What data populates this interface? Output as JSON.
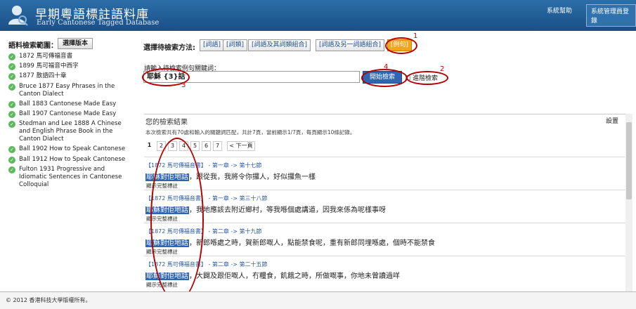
{
  "header": {
    "title_zh": "早期粵語標註語料庫",
    "title_en": "Early Cantonese Tagged Database",
    "help_link": "系統幫助",
    "admin_login": "系統管理員登錄"
  },
  "sidebar": {
    "scope_label": "語料檢索範圍：",
    "select_button": "選擇版本",
    "corpora": [
      "1872 馬可傳福音書",
      "1899 馬可福音中西字",
      "1877 散語四十章",
      "Bruce 1877 Easy Phrases in the Canton Dialect",
      "Ball 1883 Cantonese Made Easy",
      "Ball 1907 Cantonese Made Easy",
      "Stedman and Lee 1888 A Chinese and English Phrase Book in the Canton Dialect",
      "Ball 1902 How to Speak Cantonese",
      "Ball 1912 How to Speak Cantonese",
      "Fulton 1931 Progressive and Idiomatic Sentences in Cantonese Colloquial"
    ]
  },
  "search": {
    "method_label": "選擇待檢索方法:",
    "methods": [
      "[詞語]",
      "[詞類]",
      "[詞語及其詞類組合]",
      "[詞語及另一詞語組合]",
      "[例句]"
    ],
    "keyword_label": "請輸入待檢索例句關鍵詞：",
    "keyword_value": "耶穌 {3}話",
    "start_button": "開始檢索",
    "advanced": "進階檢索"
  },
  "results": {
    "title": "您的檢索結果",
    "settings": "設置",
    "summary": "本次檢索共有70處和輸入的關鍵詞匹配，共計7頁，當前顯示1/7頁，每頁顯示10條記錄。",
    "pages": [
      "1",
      "2",
      "3",
      "4",
      "5",
      "6",
      "7"
    ],
    "next_page": "< 下一頁",
    "show_full": "顯示完整標註",
    "items": [
      {
        "source": "【1872 馬可傳福音書】 - 第一章 -> 第十七節",
        "highlight": "耶穌對佢地話",
        "rest": "，跟從我，我將令你攞人，好似攞魚一樣"
      },
      {
        "source": "【1872 馬可傳福音書】 - 第一章 -> 第三十八節",
        "highlight": "耶穌對佢地話",
        "rest": "，我地應該去附近鄉村，等我喺個處講道，因我來係為呢樣事呀"
      },
      {
        "source": "【1872 馬可傳福音書】 - 第二章 -> 第十九節",
        "highlight": "耶穌對佢地話",
        "rest": "，新郎喺處之時，賀新郎嘅人，點能禁食呢，重有新郎同埋喺處，個時不能禁食"
      },
      {
        "source": "【1872 馬可傳福音書】 - 第二章 -> 第二十五節",
        "highlight": "耶穌對佢地話",
        "rest": "，大闢及跟佢嘅人，冇糧食，飢餓之時，所做嘅事，你地未曾讀過咩"
      }
    ]
  },
  "annotations": [
    "1",
    "2",
    "3",
    "4"
  ],
  "footer": "© 2012 香港科技大學版權所有。",
  "colors": {
    "header": "#1b4f86",
    "accent": "#f0a51e",
    "highlight": "#2f66b3",
    "annotation": "#c00000"
  }
}
